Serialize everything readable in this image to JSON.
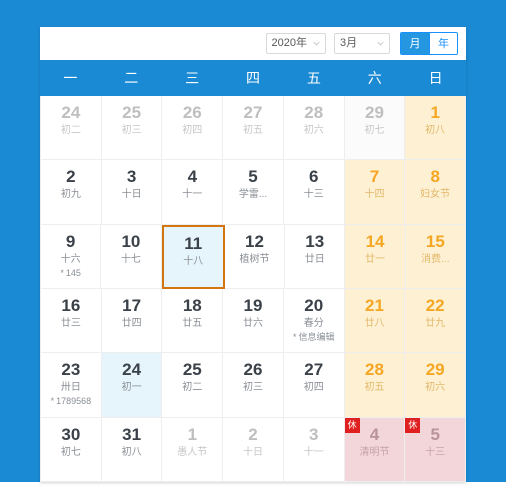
{
  "toolbar": {
    "year_select": {
      "value": "2020年"
    },
    "month_select": {
      "value": "3月"
    },
    "view_toggle": {
      "month_label": "月",
      "year_label": "年",
      "active": "月"
    }
  },
  "weekdays": [
    "一",
    "二",
    "三",
    "四",
    "五",
    "六",
    "日"
  ],
  "weeks": [
    [
      {
        "num": "24",
        "lunar": "初二",
        "state": "muted"
      },
      {
        "num": "25",
        "lunar": "初三",
        "state": "muted"
      },
      {
        "num": "26",
        "lunar": "初四",
        "state": "muted"
      },
      {
        "num": "27",
        "lunar": "初五",
        "state": "muted"
      },
      {
        "num": "28",
        "lunar": "初六",
        "state": "muted"
      },
      {
        "num": "29",
        "lunar": "初七",
        "state": "muted-weekend"
      },
      {
        "num": "1",
        "lunar": "初八",
        "state": "weekend"
      }
    ],
    [
      {
        "num": "2",
        "lunar": "初九",
        "state": "normal"
      },
      {
        "num": "3",
        "lunar": "十日",
        "state": "normal"
      },
      {
        "num": "4",
        "lunar": "十一",
        "state": "normal"
      },
      {
        "num": "5",
        "lunar": "学雷...",
        "state": "normal"
      },
      {
        "num": "6",
        "lunar": "十三",
        "state": "normal"
      },
      {
        "num": "7",
        "lunar": "十四",
        "state": "weekend"
      },
      {
        "num": "8",
        "lunar": "妇女节",
        "state": "weekend"
      }
    ],
    [
      {
        "num": "9",
        "lunar": "十六",
        "note": "145",
        "state": "normal"
      },
      {
        "num": "10",
        "lunar": "十七",
        "state": "normal"
      },
      {
        "num": "11",
        "lunar": "十八",
        "state": "selected"
      },
      {
        "num": "12",
        "lunar": "植树节",
        "state": "normal"
      },
      {
        "num": "13",
        "lunar": "廿日",
        "state": "normal"
      },
      {
        "num": "14",
        "lunar": "廿一",
        "state": "weekend"
      },
      {
        "num": "15",
        "lunar": "消费...",
        "state": "weekend"
      }
    ],
    [
      {
        "num": "16",
        "lunar": "廿三",
        "state": "normal"
      },
      {
        "num": "17",
        "lunar": "廿四",
        "state": "normal"
      },
      {
        "num": "18",
        "lunar": "廿五",
        "state": "normal"
      },
      {
        "num": "19",
        "lunar": "廿六",
        "state": "normal"
      },
      {
        "num": "20",
        "lunar": "春分",
        "note": "信息编辑",
        "state": "normal"
      },
      {
        "num": "21",
        "lunar": "廿八",
        "state": "weekend"
      },
      {
        "num": "22",
        "lunar": "廿九",
        "state": "weekend"
      }
    ],
    [
      {
        "num": "23",
        "lunar": "卅日",
        "note": "1789568",
        "state": "normal"
      },
      {
        "num": "24",
        "lunar": "初一",
        "state": "today"
      },
      {
        "num": "25",
        "lunar": "初二",
        "state": "normal"
      },
      {
        "num": "26",
        "lunar": "初三",
        "state": "normal"
      },
      {
        "num": "27",
        "lunar": "初四",
        "state": "normal"
      },
      {
        "num": "28",
        "lunar": "初五",
        "state": "weekend"
      },
      {
        "num": "29",
        "lunar": "初六",
        "state": "weekend"
      }
    ],
    [
      {
        "num": "30",
        "lunar": "初七",
        "state": "normal"
      },
      {
        "num": "31",
        "lunar": "初八",
        "state": "normal"
      },
      {
        "num": "1",
        "lunar": "愚人节",
        "state": "muted"
      },
      {
        "num": "2",
        "lunar": "十日",
        "state": "muted"
      },
      {
        "num": "3",
        "lunar": "十一",
        "state": "muted"
      },
      {
        "num": "4",
        "lunar": "清明节",
        "state": "holiday",
        "badge": "休"
      },
      {
        "num": "5",
        "lunar": "十三",
        "state": "holiday",
        "badge": "休"
      }
    ]
  ],
  "colors": {
    "page_background": "#1a8ad4",
    "header_blue": "#1a8ad4",
    "weekend_cream": "#fdf0d3",
    "weekend_text": "#f5a623",
    "selected_border": "#d4760e",
    "today_blue": "#e6f4fb",
    "holiday_pink": "#f3d6da",
    "rest_badge_red": "#e02020"
  }
}
